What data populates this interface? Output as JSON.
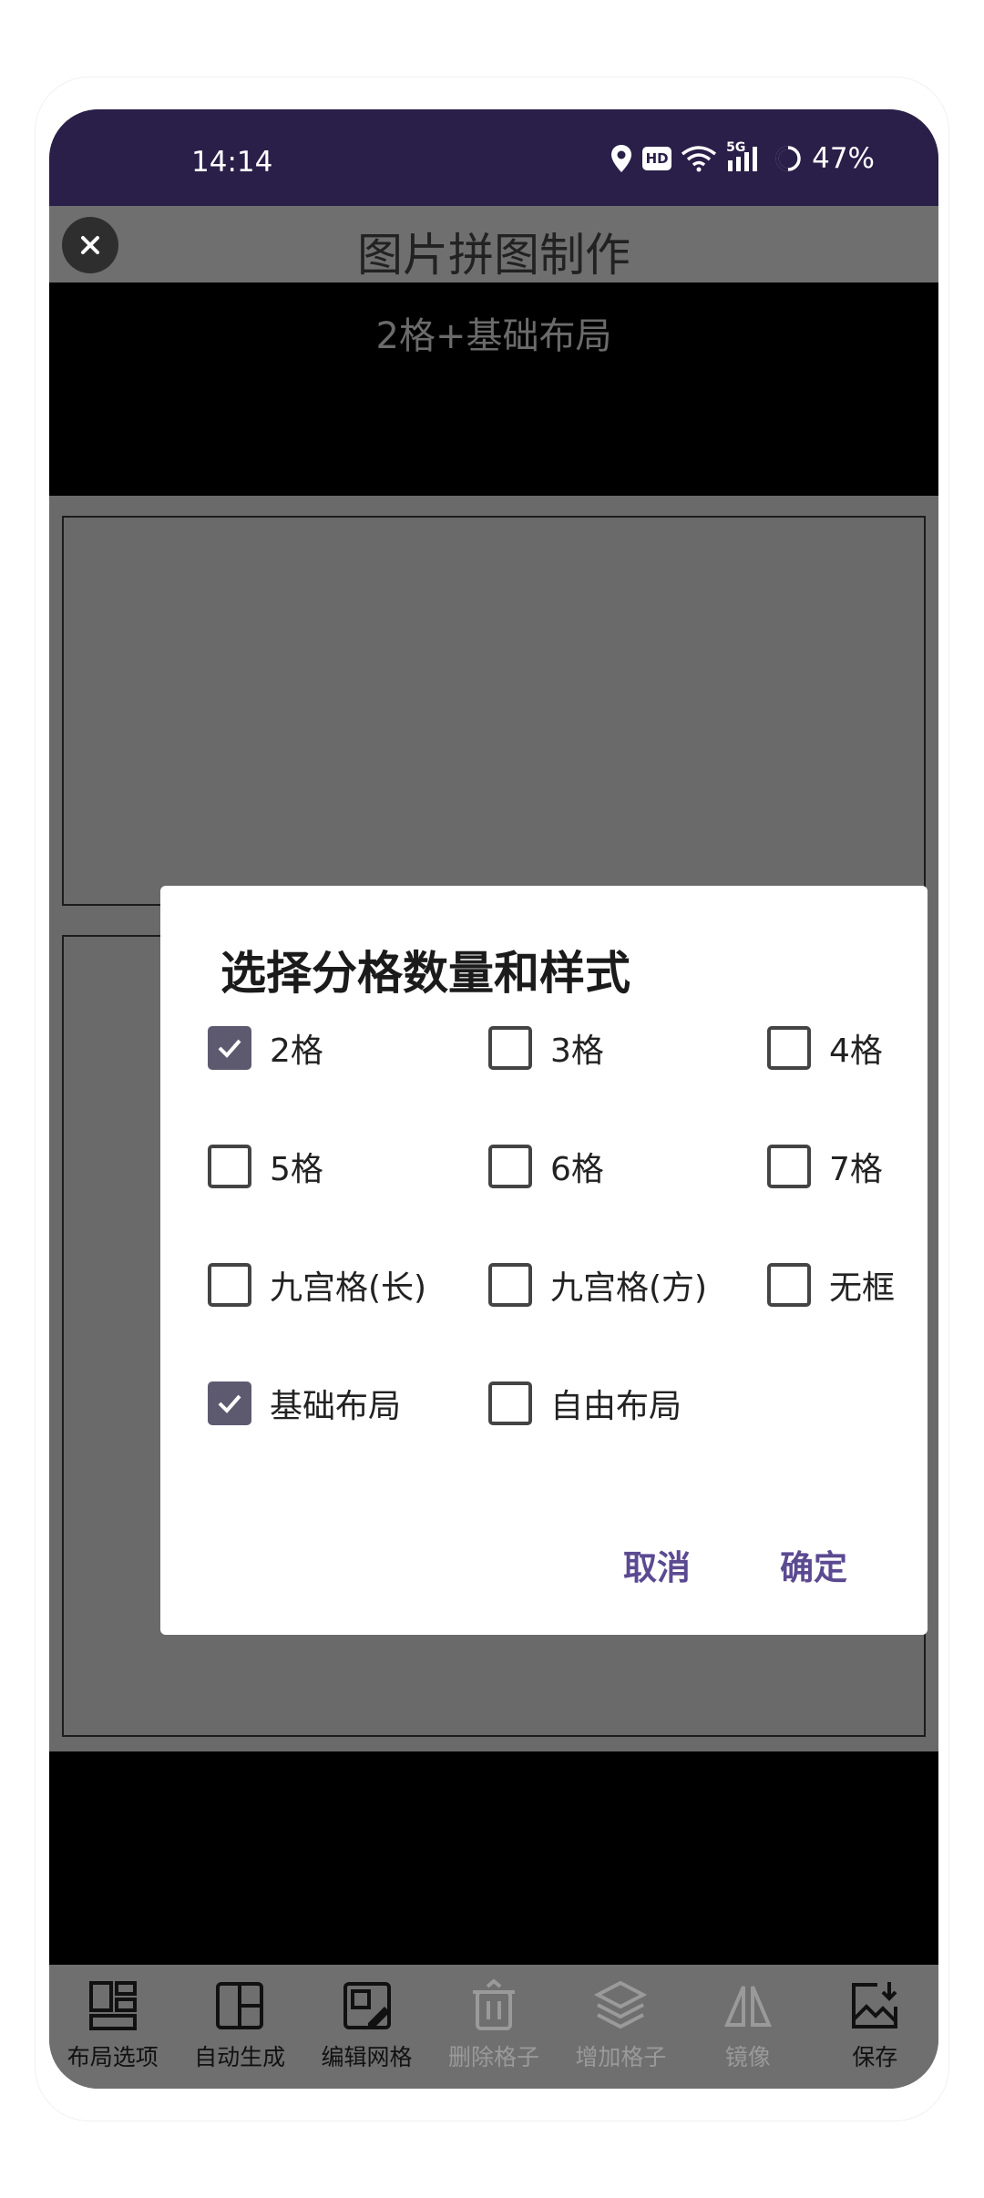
{
  "status": {
    "time": "14:14",
    "hd_badge": "HD",
    "network": "5G",
    "battery": "47%"
  },
  "header": {
    "title": "图片拼图制作"
  },
  "preview": {
    "layout_caption": "2格+基础布局"
  },
  "dialog": {
    "title": "选择分格数量和样式",
    "options": [
      {
        "label": "2格",
        "checked": true
      },
      {
        "label": "3格",
        "checked": false
      },
      {
        "label": "4格",
        "checked": false
      },
      {
        "label": "5格",
        "checked": false
      },
      {
        "label": "6格",
        "checked": false
      },
      {
        "label": "7格",
        "checked": false
      },
      {
        "label": "九宫格(长)",
        "checked": false
      },
      {
        "label": "九宫格(方)",
        "checked": false
      },
      {
        "label": "无框",
        "checked": false
      },
      {
        "label": "基础布局",
        "checked": true
      },
      {
        "label": "自由布局",
        "checked": false
      }
    ],
    "cancel_label": "取消",
    "confirm_label": "确定"
  },
  "toolbar": {
    "items": [
      {
        "label": "布局选项",
        "icon": "layout-icon",
        "enabled": true
      },
      {
        "label": "自动生成",
        "icon": "grid-icon",
        "enabled": true
      },
      {
        "label": "编辑网格",
        "icon": "edit-grid-icon",
        "enabled": true
      },
      {
        "label": "删除格子",
        "icon": "trash-icon",
        "enabled": false
      },
      {
        "label": "增加格子",
        "icon": "layers-icon",
        "enabled": false
      },
      {
        "label": "镜像",
        "icon": "mirror-icon",
        "enabled": false
      },
      {
        "label": "保存",
        "icon": "save-image-icon",
        "enabled": true
      }
    ]
  },
  "colors": {
    "statusbar": "#2a1f49",
    "accent": "#5b4a91",
    "checkbox_checked": "#5d5a70"
  }
}
